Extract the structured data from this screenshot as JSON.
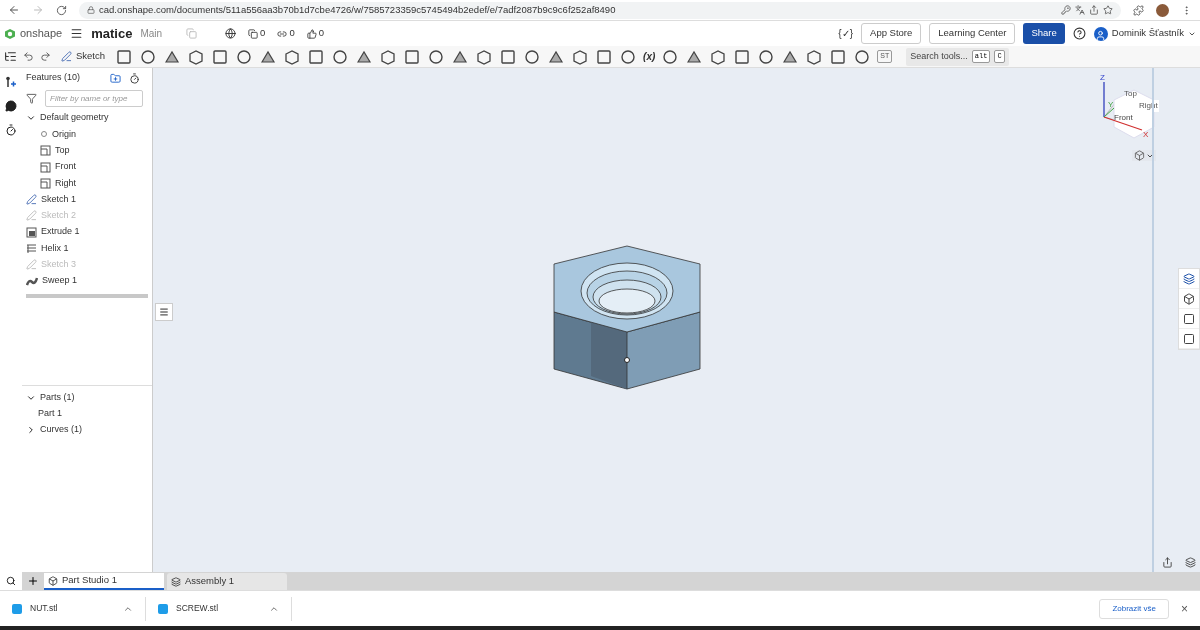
{
  "browser": {
    "url": "cad.onshape.com/documents/511a556aa3b70b1d7cbe4726/w/7585723359c5745494b2edef/e/7adf2087b9c9c6f252af8490"
  },
  "header": {
    "brand": "onshape",
    "document": "matice",
    "branch": "Main",
    "counts": [
      "0",
      "0",
      "0"
    ],
    "variables": "{✓}",
    "buttons": [
      {
        "label": "App Store",
        "kind": "plain"
      },
      {
        "label": "Learning Center",
        "kind": "plain"
      },
      {
        "label": "Share",
        "kind": "primary"
      }
    ],
    "user": "Dominik Šťastník"
  },
  "toolbar": {
    "sketch": "Sketch",
    "variable": "(x)",
    "st": "ST",
    "search": "Search tools...",
    "shortcut": [
      "alt",
      "C"
    ]
  },
  "features": {
    "title": "Features (10)",
    "filter_placeholder": "Filter by name or type",
    "items": [
      {
        "label": "Default geometry",
        "kind": "group",
        "expanded": true,
        "hidden": false,
        "children": [
          {
            "label": "Origin",
            "kind": "origin",
            "hidden": false
          },
          {
            "label": "Top",
            "kind": "plane",
            "hidden": false
          },
          {
            "label": "Front",
            "kind": "plane",
            "hidden": false
          },
          {
            "label": "Right",
            "kind": "plane",
            "hidden": false
          }
        ]
      },
      {
        "label": "Sketch 1",
        "kind": "sketch",
        "hidden": false
      },
      {
        "label": "Sketch 2",
        "kind": "sketch",
        "hidden": true
      },
      {
        "label": "Extrude 1",
        "kind": "extrude",
        "hidden": false
      },
      {
        "label": "Helix 1",
        "kind": "helix",
        "hidden": false
      },
      {
        "label": "Sketch 3",
        "kind": "sketch",
        "hidden": true
      },
      {
        "label": "Sweep 1",
        "kind": "sweep",
        "hidden": false
      }
    ]
  },
  "parts": [
    {
      "label": "Parts (1)",
      "expanded": true,
      "children": [
        {
          "label": "Part 1"
        }
      ]
    },
    {
      "label": "Curves (1)",
      "expanded": false
    }
  ],
  "view_cube": {
    "faces": [
      "Top",
      "Front",
      "Right"
    ],
    "axes": [
      "Z",
      "Y",
      "X"
    ]
  },
  "tabs": [
    {
      "label": "Part Studio 1",
      "kind": "partstudio",
      "selected": true
    },
    {
      "label": "Assembly 1",
      "kind": "assembly",
      "selected": false
    }
  ],
  "downloads": {
    "files": [
      "NUT.stl",
      "SCREW.stl"
    ],
    "show_all": "Zobrazit vše",
    "close": "×"
  }
}
